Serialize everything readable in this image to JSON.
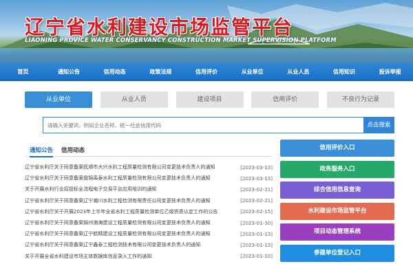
{
  "banner": {
    "title": "辽宁省水利建设市场监管平台",
    "subtitle": "LIAONING PROVICE WATER CONSERVANCY CONSTRUCTION MARKET SUPERVISION PLATFORM"
  },
  "nav": [
    "首页",
    "通知公告",
    "信用动态",
    "政策法规",
    "信用评价",
    "从业单位",
    "从业人员",
    "信用知识",
    "投诉举报"
  ],
  "tabs": [
    {
      "label": "从业单位",
      "active": true
    },
    {
      "label": "从业人员",
      "active": false
    },
    {
      "label": "建设项目",
      "active": false
    },
    {
      "label": "信用评价",
      "active": false
    },
    {
      "label": "不良行为记录",
      "active": false
    }
  ],
  "search": {
    "placeholder": "请输入关键词，例如企业名称、统一社会信用代码",
    "button_label": "点击搜索"
  },
  "news_tabs": [
    "通知公告",
    "信用动态"
  ],
  "news": [
    {
      "title": "辽宁省水利厅关于同意备案抚顺市大兴水利工程质量检测有限公司变更技术负责人的通知",
      "date": "[2023-03-13]"
    },
    {
      "title": "辽宁省水利厅关于同意备案盘锦禹泰水利工程质量检测有限公司变更技术负责人的通知",
      "date": "[2023-03-13]"
    },
    {
      "title": "关于开展水利行业招投标全流程电子交易平台应用培训的通知",
      "date": "[2023-02-21]"
    },
    {
      "title": "辽宁省水利厅关于同意备案辽宁瀚川水利工程检测有限责任公司变更技术负责人的通知",
      "date": "[2023-02-21]"
    },
    {
      "title": "辽宁省水利厅关于开展2023年上半年全省水利工程质量检测单位乙级资质认定工作的公告",
      "date": "[2023-02-15]"
    },
    {
      "title": "辽宁省水利厅关于同意备案锦州渤海建设工程质量检测有限公司变更技术负责人的通知",
      "date": "[2023-01-30]"
    },
    {
      "title": "辽宁省水利厅关于同意备案辽宁航精建设工程质量检测有限公司变更技术负责人的通知",
      "date": "[2023-01-13]"
    },
    {
      "title": "辽宁省水利厅关于同意备案辽宁鑫泰工程检测技术有限公司变更技术负责人的通知",
      "date": "[2023-01-13]"
    },
    {
      "title": "关于开展全省水利建设市场主体数据库信息录入工作的通知",
      "date": "[2023-01-10]"
    }
  ],
  "side_buttons": [
    {
      "label": "信用评价入口",
      "color": "#3b8fd9"
    },
    {
      "label": "政务服务入口",
      "color": "#25a86a"
    },
    {
      "label": "综合信用信息查询",
      "color": "#7a5ed6"
    },
    {
      "label": "水利建设市场监管平台",
      "color": "#e36b4f"
    },
    {
      "label": "项目动态管理系统",
      "color": "#9a3fbf"
    },
    {
      "label": "参建单位登记入口",
      "color": "#1f8de0"
    }
  ]
}
